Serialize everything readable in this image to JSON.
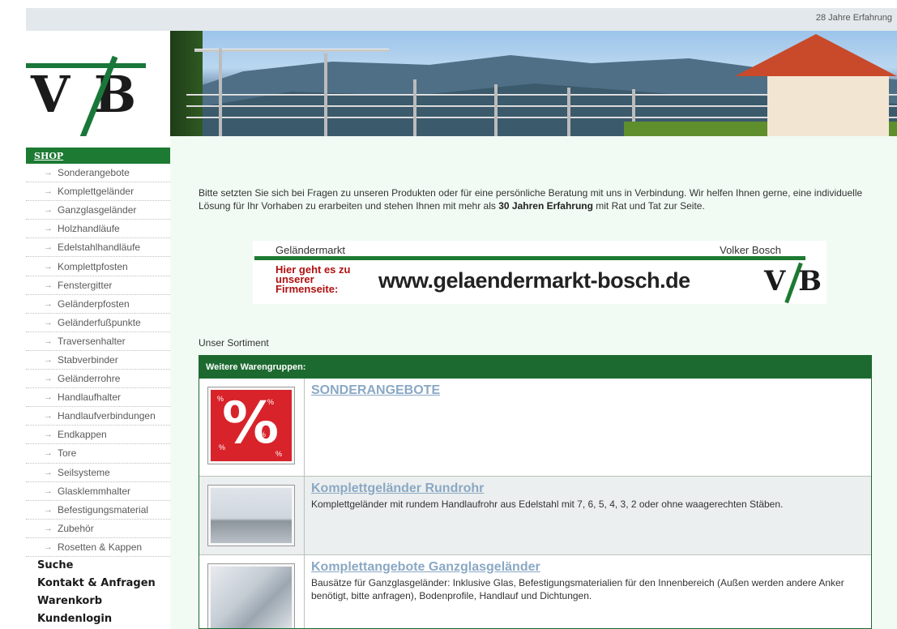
{
  "topbar": {
    "experience": "28 Jahre Erfahrung"
  },
  "logo": {
    "text": "V/B"
  },
  "sidebar": {
    "shop_label": "SHOP",
    "items": [
      "Sonderangebote",
      "Komplettgeländer",
      "Ganzglasgeländer",
      "Holzhandläufe",
      "Edelstahlhandläufe",
      "Komplettpfosten",
      "Fenstergitter",
      "Geländerpfosten",
      "Geländerfußpunkte",
      "Traversenhalter",
      "Stabverbinder",
      "Geländerrohre",
      "Handlaufhalter",
      "Handlaufverbindungen",
      "Endkappen",
      "Tore",
      "Seilsysteme",
      "Glasklemmhalter",
      "Befestigungsmaterial",
      "Zubehör",
      "Rosetten & Kappen"
    ],
    "main_links": [
      "Suche",
      "Kontakt & Anfragen",
      "Warenkorb",
      "Kundenlogin"
    ]
  },
  "intro": {
    "part1": "Bitte setzten Sie sich bei Fragen zu unseren Produkten oder für eine persönliche Beratung mit uns in Verbindung. Wir helfen Ihnen gerne, eine individuelle Lösung für Ihr Vorhaben zu erarbeiten und stehen Ihnen mit mehr als ",
    "bold": "30 Jahren Erfahrung",
    "part2": " mit Rat und Tat zur Seite."
  },
  "banner": {
    "company": "Geländermarkt",
    "owner": "Volker Bosch",
    "hier_line1": "Hier geht es zu",
    "hier_line2": "unserer",
    "hier_line3": "Firmenseite:",
    "url": "www.gelaendermarkt-bosch.de",
    "mini_logo": "V/B"
  },
  "sortiment_label": "Unser Sortiment",
  "table": {
    "header": "Weitere Warengruppen:",
    "rows": [
      {
        "title": "SONDERANGEBOTE",
        "desc": "",
        "thumb_icon": "percent-icon"
      },
      {
        "title": "Komplettgeländer Rundrohr",
        "desc": "Komplettgeländer mit rundem Handlaufrohr aus Edelstahl mit 7, 6, 5, 4, 3, 2 oder ohne waagerechten Stäben.",
        "thumb_icon": "railing-photo"
      },
      {
        "title": "Komplettangebote Ganzglasgeländer",
        "desc": "Bausätze für Ganzglasgeländer: Inklusive Glas, Befestigungsmaterialien für den Innenbereich (Außen werden andere Anker benötigt, bitte anfragen), Bodenprofile, Handlauf und Dichtungen.",
        "thumb_icon": "glass-railing-photo"
      }
    ]
  },
  "colors": {
    "brand_green": "#1d7a32",
    "link_blue": "#8aa8c4",
    "content_bg": "#f1fbf3"
  }
}
